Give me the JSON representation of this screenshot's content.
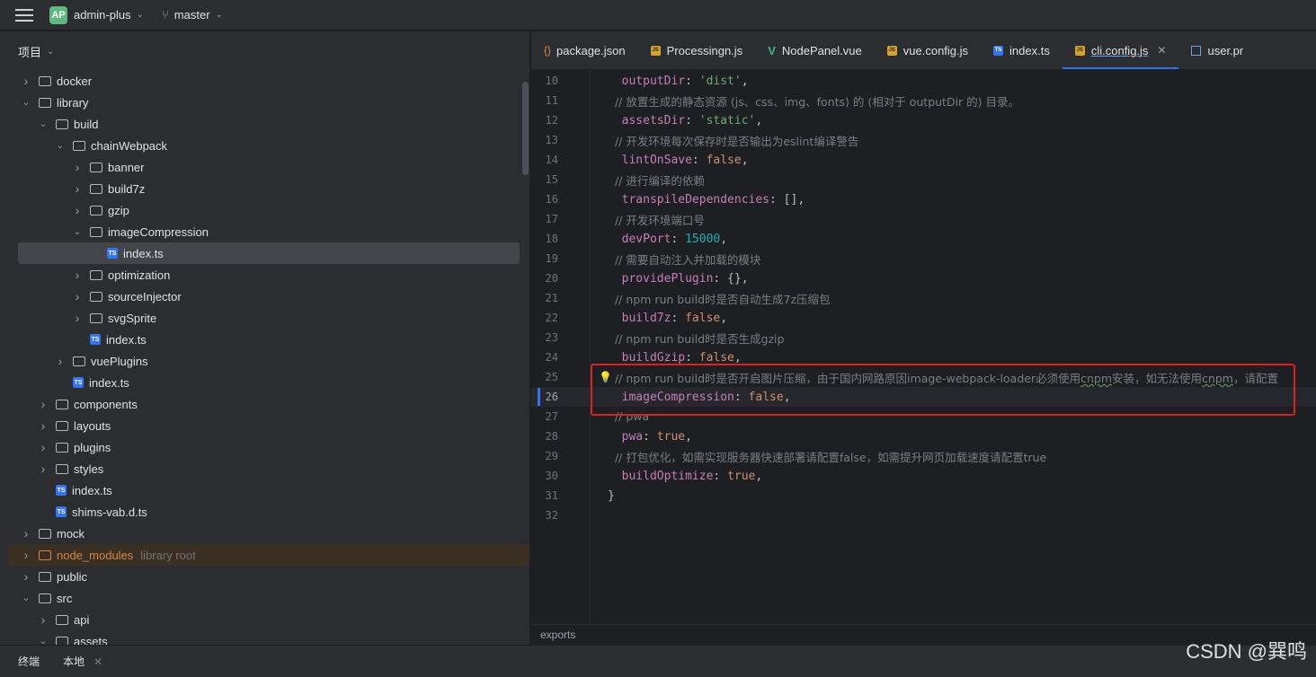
{
  "titlebar": {
    "project_badge": "AP",
    "project_name": "admin-plus",
    "branch_name": "master"
  },
  "project_panel": {
    "title": "项目",
    "tree": [
      {
        "label": "docker",
        "type": "folder",
        "depth": 1,
        "expanded": false
      },
      {
        "label": "library",
        "type": "folder",
        "depth": 1,
        "expanded": true
      },
      {
        "label": "build",
        "type": "folder",
        "depth": 2,
        "expanded": true
      },
      {
        "label": "chainWebpack",
        "type": "folder",
        "depth": 3,
        "expanded": true
      },
      {
        "label": "banner",
        "type": "folder",
        "depth": 4,
        "expanded": false
      },
      {
        "label": "build7z",
        "type": "folder",
        "depth": 4,
        "expanded": false
      },
      {
        "label": "gzip",
        "type": "folder",
        "depth": 4,
        "expanded": false
      },
      {
        "label": "imageCompression",
        "type": "folder",
        "depth": 4,
        "expanded": true
      },
      {
        "label": "index.ts",
        "type": "ts",
        "depth": 5,
        "selected": true
      },
      {
        "label": "optimization",
        "type": "folder",
        "depth": 4,
        "expanded": false
      },
      {
        "label": "sourceInjector",
        "type": "folder",
        "depth": 4,
        "expanded": false
      },
      {
        "label": "svgSprite",
        "type": "folder",
        "depth": 4,
        "expanded": false
      },
      {
        "label": "index.ts",
        "type": "ts",
        "depth": 4
      },
      {
        "label": "vuePlugins",
        "type": "folder",
        "depth": 3,
        "expanded": false
      },
      {
        "label": "index.ts",
        "type": "ts",
        "depth": 3
      },
      {
        "label": "components",
        "type": "folder",
        "depth": 2,
        "expanded": false
      },
      {
        "label": "layouts",
        "type": "folder",
        "depth": 2,
        "expanded": false
      },
      {
        "label": "plugins",
        "type": "folder",
        "depth": 2,
        "expanded": false
      },
      {
        "label": "styles",
        "type": "folder",
        "depth": 2,
        "expanded": false
      },
      {
        "label": "index.ts",
        "type": "ts",
        "depth": 2
      },
      {
        "label": "shims-vab.d.ts",
        "type": "ts",
        "depth": 2
      },
      {
        "label": "mock",
        "type": "folder",
        "depth": 1,
        "expanded": false
      },
      {
        "label": "node_modules",
        "type": "folder-orange",
        "depth": 1,
        "expanded": false,
        "sublabel": "library root"
      },
      {
        "label": "public",
        "type": "folder",
        "depth": 1,
        "expanded": false
      },
      {
        "label": "src",
        "type": "folder",
        "depth": 1,
        "expanded": true
      },
      {
        "label": "api",
        "type": "folder",
        "depth": 2,
        "expanded": false
      },
      {
        "label": "assets",
        "type": "folder",
        "depth": 2,
        "expanded": true
      }
    ]
  },
  "tabs": [
    {
      "label": "package.json",
      "icon": "json-icon"
    },
    {
      "label": "Processingn.js",
      "icon": "js-icon"
    },
    {
      "label": "NodePanel.vue",
      "icon": "vue-icon"
    },
    {
      "label": "vue.config.js",
      "icon": "js-icon"
    },
    {
      "label": "index.ts",
      "icon": "ts-icon"
    },
    {
      "label": "cli.config.js",
      "icon": "js-icon",
      "active": true
    },
    {
      "label": "user.pr",
      "icon": "user-file-icon"
    }
  ],
  "editor": {
    "lines": [
      {
        "num": "10",
        "parts": [
          [
            "k",
            "  outputDir"
          ],
          [
            "p",
            ": "
          ],
          [
            "s",
            "'dist'"
          ],
          [
            "p",
            ","
          ]
        ]
      },
      {
        "num": "11",
        "parts": [
          [
            "c",
            "  // 放置生成的静态资源 (js、css、img、fonts) 的 (相对于 outputDir 的) 目录。"
          ]
        ]
      },
      {
        "num": "12",
        "parts": [
          [
            "k",
            "  assetsDir"
          ],
          [
            "p",
            ": "
          ],
          [
            "s",
            "'static'"
          ],
          [
            "p",
            ","
          ]
        ]
      },
      {
        "num": "13",
        "parts": [
          [
            "c",
            "  // 开发环境每次保存时是否输出为eslint编译警告"
          ]
        ]
      },
      {
        "num": "14",
        "parts": [
          [
            "k",
            "  lintOnSave"
          ],
          [
            "p",
            ": "
          ],
          [
            "kw",
            "false"
          ],
          [
            "p",
            ","
          ]
        ]
      },
      {
        "num": "15",
        "parts": [
          [
            "c",
            "  // 进行编译的依赖"
          ]
        ]
      },
      {
        "num": "16",
        "parts": [
          [
            "k",
            "  transpileDependencies"
          ],
          [
            "p",
            ": [],"
          ]
        ]
      },
      {
        "num": "17",
        "parts": [
          [
            "c",
            "  // 开发环境端口号"
          ]
        ]
      },
      {
        "num": "18",
        "parts": [
          [
            "k",
            "  devPort"
          ],
          [
            "p",
            ": "
          ],
          [
            "n",
            "15000"
          ],
          [
            "p",
            ","
          ]
        ]
      },
      {
        "num": "19",
        "parts": [
          [
            "c",
            "  // 需要自动注入并加载的模块"
          ]
        ]
      },
      {
        "num": "20",
        "parts": [
          [
            "k",
            "  providePlugin"
          ],
          [
            "p",
            ": {},"
          ]
        ]
      },
      {
        "num": "21",
        "parts": [
          [
            "c",
            "  // npm run build时是否自动生成7z压缩包"
          ]
        ]
      },
      {
        "num": "22",
        "parts": [
          [
            "k",
            "  build7z"
          ],
          [
            "p",
            ": "
          ],
          [
            "kw",
            "false"
          ],
          [
            "p",
            ","
          ]
        ]
      },
      {
        "num": "23",
        "parts": [
          [
            "c",
            "  // npm run build时是否生成gzip"
          ]
        ]
      },
      {
        "num": "24",
        "parts": [
          [
            "k",
            "  buildGzip"
          ],
          [
            "p",
            ": "
          ],
          [
            "kw",
            "false"
          ],
          [
            "p",
            ","
          ]
        ]
      },
      {
        "num": "25",
        "parts": [
          [
            "c",
            "  // npm run build时是否开启图片压缩，由于国内网路原因image-webpack-loader必须使用"
          ],
          [
            "csq",
            "cnpm"
          ],
          [
            "c",
            "安装，如无法使用"
          ],
          [
            "csq",
            "cnpm"
          ],
          [
            "c",
            "，请配置"
          ]
        ]
      },
      {
        "num": "26",
        "parts": [
          [
            "k",
            "  imageCompression"
          ],
          [
            "p",
            ": "
          ],
          [
            "kw",
            "false"
          ],
          [
            "p",
            ","
          ]
        ],
        "current": true
      },
      {
        "num": "27",
        "parts": [
          [
            "c",
            "  // pwa"
          ]
        ]
      },
      {
        "num": "28",
        "parts": [
          [
            "k",
            "  pwa"
          ],
          [
            "p",
            ": "
          ],
          [
            "kw",
            "true"
          ],
          [
            "p",
            ","
          ]
        ]
      },
      {
        "num": "29",
        "parts": [
          [
            "c",
            "  // 打包优化，如需实现服务器快速部署请配置false，如需提升网页加载速度请配置true"
          ]
        ]
      },
      {
        "num": "30",
        "parts": [
          [
            "k",
            "  buildOptimize"
          ],
          [
            "p",
            ": "
          ],
          [
            "kw",
            "true"
          ],
          [
            "p",
            ","
          ]
        ]
      },
      {
        "num": "31",
        "parts": [
          [
            "p",
            "}"
          ]
        ]
      },
      {
        "num": "32",
        "parts": []
      }
    ]
  },
  "breadcrumb": "exports",
  "bottombar": {
    "terminal_label": "终端",
    "local_tab": "本地"
  },
  "watermark": "CSDN @巽鸣",
  "colors": {
    "accent": "#3574f0",
    "highlight_box": "#e02020",
    "property": "#c77dbb",
    "string": "#6aab73",
    "number": "#2aacb8",
    "keyword": "#cf8e6d"
  }
}
